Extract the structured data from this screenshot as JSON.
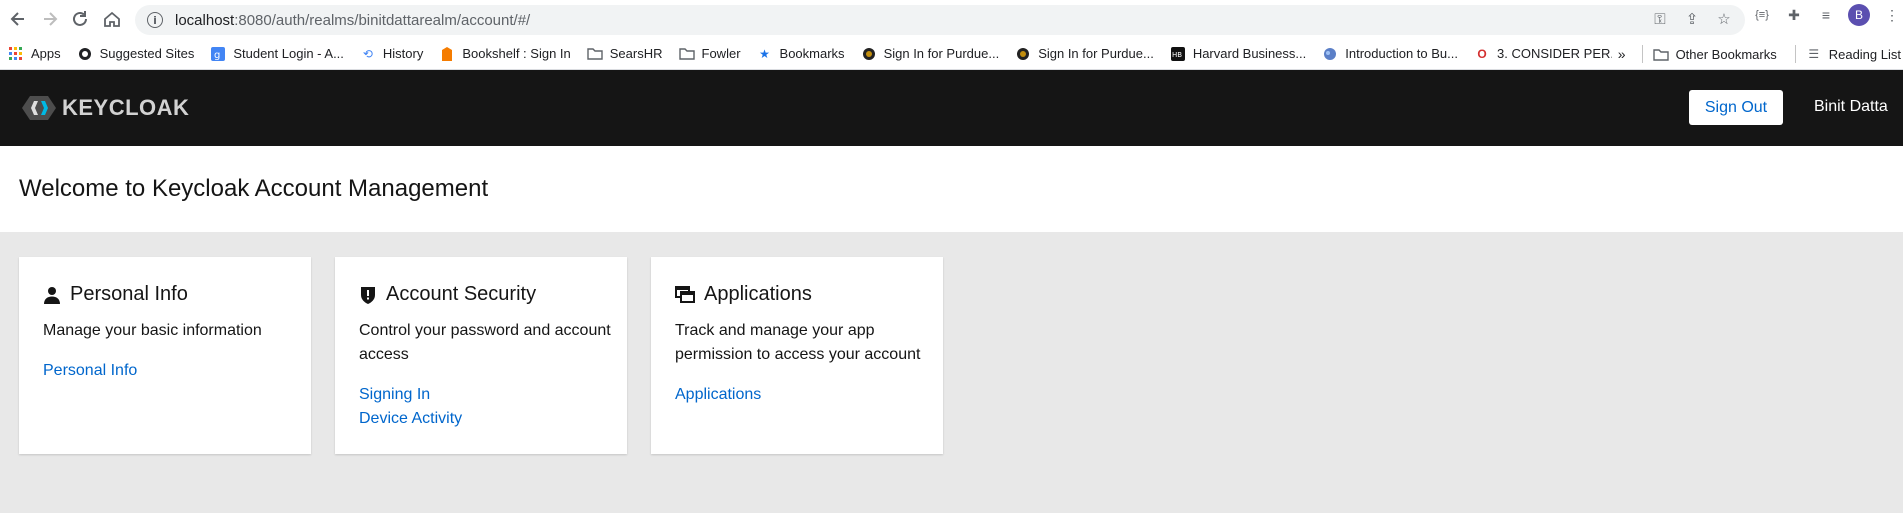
{
  "browser": {
    "url_host": "localhost",
    "url_rest": ":8080/auth/realms/binitdattarealm/account/#/",
    "avatar_letter": "B",
    "bookmarks": [
      {
        "label": "Apps",
        "icon": "apps-grid-icon"
      },
      {
        "label": "Suggested Sites",
        "icon": "globe-icon"
      },
      {
        "label": "Student Login - A...",
        "icon": "google-icon"
      },
      {
        "label": "History",
        "icon": "history-icon"
      },
      {
        "label": "Bookshelf : Sign In",
        "icon": "bookshelf-icon"
      },
      {
        "label": "SearsHR",
        "icon": "folder-icon"
      },
      {
        "label": "Fowler",
        "icon": "folder-icon"
      },
      {
        "label": "Bookmarks",
        "icon": "star-icon"
      },
      {
        "label": "Sign In for Purdue...",
        "icon": "purdue-icon"
      },
      {
        "label": "Sign In for Purdue...",
        "icon": "purdue-icon"
      },
      {
        "label": "Harvard Business...",
        "icon": "hb-icon"
      },
      {
        "label": "Introduction to Bu...",
        "icon": "globe-icon"
      },
      {
        "label": "3. CONSIDER PER...",
        "icon": "o-icon"
      }
    ],
    "overflow": "»",
    "other_bookmarks": "Other Bookmarks",
    "reading_list": "Reading List"
  },
  "header": {
    "logo_text": "KEYCLOAK",
    "signout_label": "Sign Out",
    "username": "Binit Datta"
  },
  "page": {
    "title": "Welcome to Keycloak Account Management"
  },
  "cards": [
    {
      "title": "Personal Info",
      "icon": "user-icon",
      "description": "Manage your basic information",
      "links": [
        "Personal Info"
      ]
    },
    {
      "title": "Account Security",
      "icon": "shield-icon",
      "description": "Control your password and account access",
      "links": [
        "Signing In",
        "Device Activity"
      ]
    },
    {
      "title": "Applications",
      "icon": "applications-icon",
      "description": "Track and manage your app permission to access your account",
      "links": [
        "Applications"
      ]
    }
  ],
  "colors": {
    "header_bg": "#151515",
    "link": "#0066cc",
    "page_bg": "#e8e8e8"
  }
}
